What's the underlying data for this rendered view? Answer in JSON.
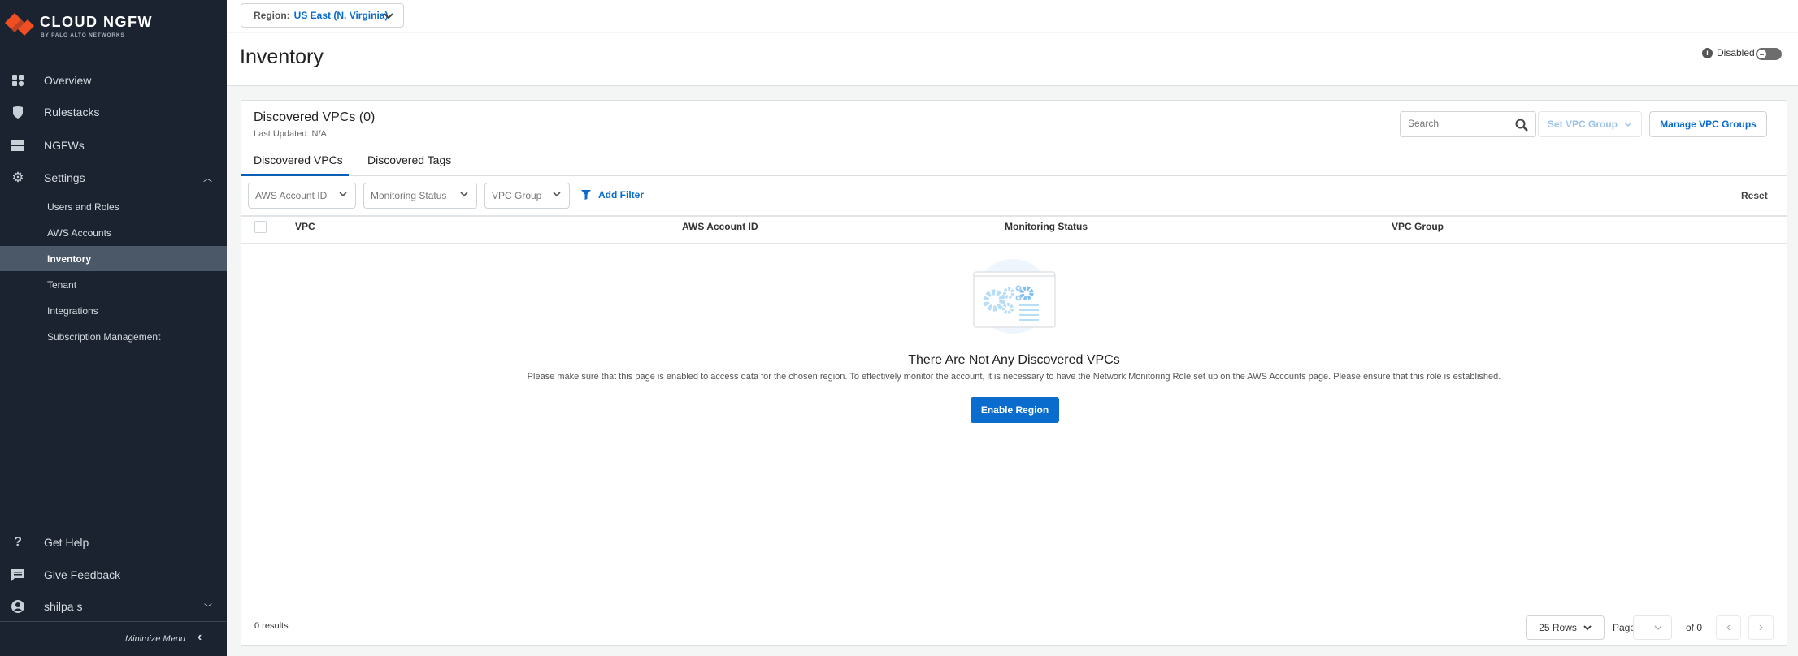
{
  "brand": {
    "name": "CLOUD NGFW",
    "subtitle": "BY PALO ALTO NETWORKS",
    "accent": "#f04e23"
  },
  "sidebar": {
    "items": [
      {
        "label": "Overview",
        "icon": "grid-icon"
      },
      {
        "label": "Rulestacks",
        "icon": "shield-icon"
      },
      {
        "label": "NGFWs",
        "icon": "server-icon"
      },
      {
        "label": "Settings",
        "icon": "gear-icon"
      }
    ],
    "settings_items": [
      "Users and Roles",
      "AWS Accounts",
      "Inventory",
      "Tenant",
      "Integrations",
      "Subscription Management"
    ],
    "active": "Inventory",
    "bottom": [
      {
        "label": "Get Help",
        "icon": "help-icon"
      },
      {
        "label": "Give Feedback",
        "icon": "feedback-icon"
      },
      {
        "label": "shilpa s",
        "icon": "user-icon"
      }
    ],
    "minimize": "Minimize Menu"
  },
  "topbar": {
    "region_label": "Region:",
    "region_value": "US East (N. Virginia)"
  },
  "page": {
    "title": "Inventory",
    "status": "Disabled"
  },
  "card": {
    "title": "Discovered VPCs (0)",
    "last_updated": "Last Updated: N/A",
    "search_placeholder": "Search",
    "set_vpc_group": "Set VPC Group",
    "manage_vpc_groups": "Manage VPC Groups",
    "tabs": [
      "Discovered VPCs",
      "Discovered Tags"
    ],
    "filters": [
      "AWS Account ID",
      "Monitoring Status",
      "VPC Group"
    ],
    "add_filter": "Add Filter",
    "reset": "Reset",
    "columns": [
      "VPC",
      "AWS Account ID",
      "Monitoring Status",
      "VPC Group"
    ],
    "empty_title": "There Are Not Any Discovered VPCs",
    "empty_desc": "Please make sure that this page is enabled to access data for the chosen region. To effectively monitor the account, it is necessary to have the Network Monitoring Role set up on the AWS Accounts page. Please ensure that this role is established.",
    "enable_region": "Enable Region",
    "results": "0 results",
    "rows": "25 Rows",
    "page_label": "Page",
    "of_pages": "of 0"
  },
  "colors": {
    "primary": "#0a6ccc",
    "sidebar": "#1b2230",
    "active": "#4a5868"
  }
}
